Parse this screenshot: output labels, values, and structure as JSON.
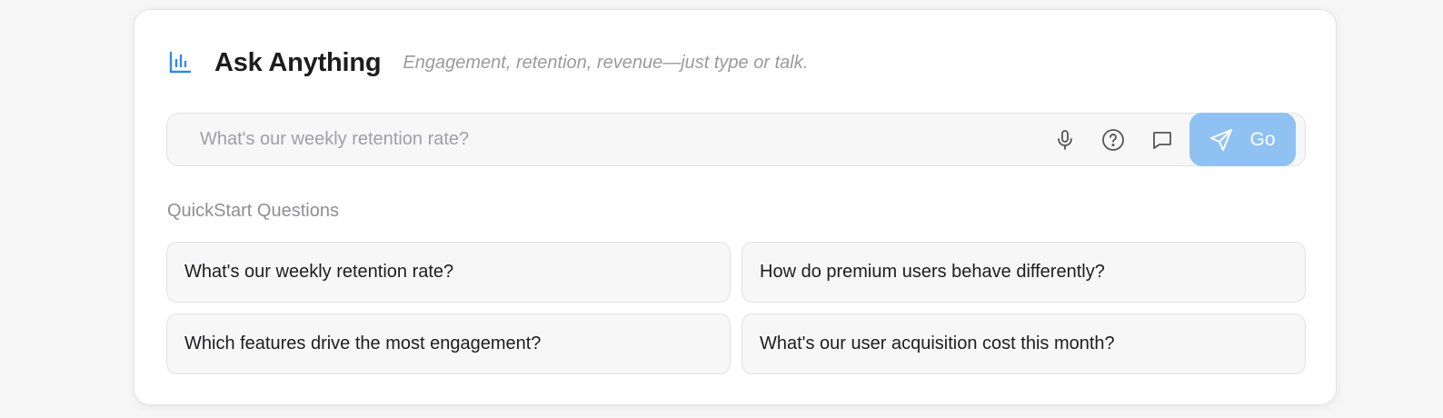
{
  "header": {
    "icon": "bar-chart-icon",
    "title": "Ask Anything",
    "subtitle": "Engagement, retention, revenue—just type or talk."
  },
  "search": {
    "placeholder": "What's our weekly retention rate?",
    "value": "",
    "icons": [
      "microphone-icon",
      "help-circle-icon",
      "chat-bubble-icon",
      "send-icon"
    ],
    "go_label": "Go"
  },
  "quickstart": {
    "heading": "QuickStart Questions",
    "items": [
      {
        "label": "What's our weekly retention rate?"
      },
      {
        "label": "How do premium users behave differently?"
      },
      {
        "label": "Which features drive the most engagement?"
      },
      {
        "label": "What's our user acquisition cost this month?"
      }
    ]
  },
  "colors": {
    "accent": "#2f8be6",
    "go_button": "#8fc2f3",
    "muted_text": "#9a9aa0"
  }
}
